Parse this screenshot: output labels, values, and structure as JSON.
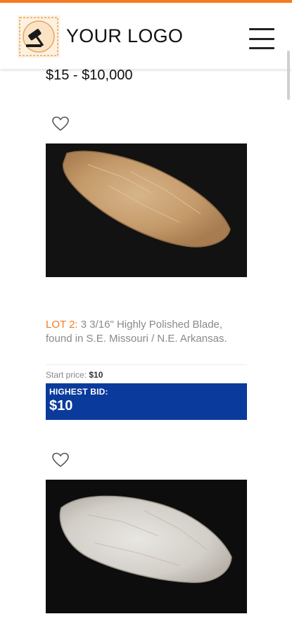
{
  "header": {
    "logo_text": "YOUR LOGO",
    "accent_color": "#f47b20",
    "logo_icon": "gavel-icon",
    "menu_icon": "hamburger-menu-icon"
  },
  "listing": {
    "price_range": "$15 - $10,000"
  },
  "lots": [
    {
      "lot_label": "LOT 2:",
      "title": " 3 3/16\" Highly Polished Blade, found in S.E. Missouri / N.E. Arkansas.",
      "start_price_label": "Start price: ",
      "start_price": "$10",
      "highest_bid_label": "HIGHEST BID:",
      "highest_bid": "$10",
      "bid_box_color": "#0a3a9c"
    }
  ],
  "icons": {
    "favorite": "heart-icon"
  }
}
